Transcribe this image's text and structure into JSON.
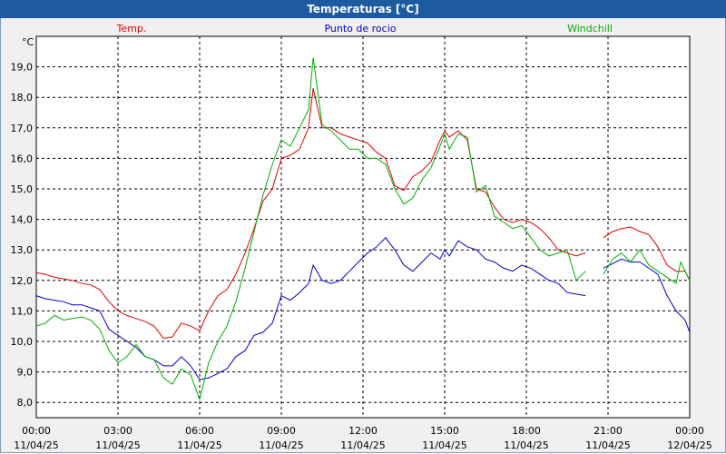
{
  "window": {
    "title": "Temperaturas [°C]"
  },
  "chart_data": {
    "type": "line",
    "ylabel": "°C",
    "ylim": [
      7.5,
      20.0
    ],
    "yticks": [
      8.0,
      9.0,
      10.0,
      11.0,
      12.0,
      13.0,
      14.0,
      15.0,
      16.0,
      17.0,
      18.0,
      19.0
    ],
    "ytick_labels": [
      "8,0",
      "9,0",
      "10,0",
      "11,0",
      "12,0",
      "13,0",
      "14,0",
      "15,0",
      "16,0",
      "17,0",
      "18,0",
      "19,0"
    ],
    "xlim": [
      0,
      24
    ],
    "xticks": [
      0,
      3,
      6,
      9,
      12,
      15,
      18,
      21,
      24
    ],
    "xtick_labels": [
      {
        "time": "00:00",
        "date": "11/04/25"
      },
      {
        "time": "03:00",
        "date": "11/04/25"
      },
      {
        "time": "06:00",
        "date": "11/04/25"
      },
      {
        "time": "09:00",
        "date": "11/04/25"
      },
      {
        "time": "12:00",
        "date": "11/04/25"
      },
      {
        "time": "15:00",
        "date": "11/04/25"
      },
      {
        "time": "18:00",
        "date": "11/04/25"
      },
      {
        "time": "21:00",
        "date": "11/04/25"
      },
      {
        "time": "00:00",
        "date": "12/04/25"
      }
    ],
    "grid": true,
    "legend_placement": "top",
    "series": [
      {
        "name": "Temp.",
        "color": "#e00000",
        "segments": [
          [
            [
              0,
              12.25
            ],
            [
              0.33,
              12.2
            ],
            [
              0.67,
              12.1
            ],
            [
              1.0,
              12.05
            ],
            [
              1.33,
              12.0
            ],
            [
              1.67,
              11.9
            ],
            [
              2.0,
              11.85
            ],
            [
              2.33,
              11.7
            ],
            [
              2.67,
              11.3
            ],
            [
              3.0,
              11.0
            ],
            [
              3.33,
              10.85
            ],
            [
              3.67,
              10.75
            ],
            [
              4.0,
              10.65
            ],
            [
              4.33,
              10.5
            ],
            [
              4.67,
              10.1
            ],
            [
              5.0,
              10.15
            ],
            [
              5.33,
              10.6
            ],
            [
              5.67,
              10.5
            ],
            [
              6.0,
              10.35
            ],
            [
              6.33,
              11.0
            ],
            [
              6.67,
              11.5
            ],
            [
              7.0,
              11.7
            ],
            [
              7.33,
              12.2
            ],
            [
              7.67,
              12.9
            ],
            [
              8.0,
              13.7
            ],
            [
              8.33,
              14.6
            ],
            [
              8.67,
              15.0
            ],
            [
              9.0,
              16.0
            ],
            [
              9.33,
              16.1
            ],
            [
              9.67,
              16.3
            ],
            [
              10.0,
              17.0
            ],
            [
              10.17,
              18.3
            ],
            [
              10.5,
              17.0
            ],
            [
              10.83,
              17.0
            ],
            [
              11.17,
              16.8
            ],
            [
              11.5,
              16.7
            ],
            [
              11.83,
              16.6
            ],
            [
              12.17,
              16.5
            ],
            [
              12.5,
              16.2
            ],
            [
              12.83,
              16.0
            ],
            [
              13.17,
              15.1
            ],
            [
              13.5,
              14.95
            ],
            [
              13.83,
              15.4
            ],
            [
              14.17,
              15.6
            ],
            [
              14.5,
              15.9
            ],
            [
              14.83,
              16.6
            ],
            [
              15.0,
              16.9
            ],
            [
              15.17,
              16.7
            ],
            [
              15.5,
              16.9
            ],
            [
              15.83,
              16.6
            ],
            [
              16.17,
              15.0
            ],
            [
              16.5,
              14.9
            ],
            [
              16.83,
              14.4
            ],
            [
              17.17,
              14.0
            ],
            [
              17.5,
              13.9
            ],
            [
              17.83,
              14.0
            ],
            [
              18.17,
              13.9
            ],
            [
              18.5,
              13.7
            ],
            [
              18.83,
              13.4
            ],
            [
              19.17,
              13.0
            ],
            [
              19.5,
              12.9
            ],
            [
              19.83,
              12.8
            ],
            [
              20.17,
              12.9
            ]
          ],
          [
            [
              20.83,
              13.4
            ],
            [
              21.17,
              13.6
            ],
            [
              21.5,
              13.7
            ],
            [
              21.83,
              13.75
            ],
            [
              22.17,
              13.6
            ],
            [
              22.5,
              13.5
            ],
            [
              22.83,
              13.1
            ],
            [
              23.17,
              12.5
            ],
            [
              23.5,
              12.3
            ],
            [
              23.83,
              12.3
            ],
            [
              24.0,
              12.0
            ]
          ]
        ]
      },
      {
        "name": "Punto de rocio",
        "color": "#0000cc",
        "segments": [
          [
            [
              0,
              11.5
            ],
            [
              0.33,
              11.4
            ],
            [
              0.67,
              11.35
            ],
            [
              1.0,
              11.3
            ],
            [
              1.33,
              11.2
            ],
            [
              1.67,
              11.2
            ],
            [
              2.0,
              11.1
            ],
            [
              2.33,
              11.0
            ],
            [
              2.67,
              10.4
            ],
            [
              3.0,
              10.2
            ],
            [
              3.33,
              10.0
            ],
            [
              3.67,
              9.8
            ],
            [
              4.0,
              9.5
            ],
            [
              4.33,
              9.4
            ],
            [
              4.67,
              9.2
            ],
            [
              5.0,
              9.2
            ],
            [
              5.33,
              9.5
            ],
            [
              5.67,
              9.2
            ],
            [
              6.0,
              8.75
            ],
            [
              6.33,
              8.8
            ],
            [
              6.67,
              8.95
            ],
            [
              7.0,
              9.1
            ],
            [
              7.33,
              9.5
            ],
            [
              7.67,
              9.7
            ],
            [
              8.0,
              10.2
            ],
            [
              8.33,
              10.3
            ],
            [
              8.67,
              10.6
            ],
            [
              9.0,
              11.5
            ],
            [
              9.33,
              11.35
            ],
            [
              9.67,
              11.6
            ],
            [
              10.0,
              11.9
            ],
            [
              10.17,
              12.5
            ],
            [
              10.5,
              12.0
            ],
            [
              10.83,
              11.9
            ],
            [
              11.17,
              12.0
            ],
            [
              11.5,
              12.3
            ],
            [
              11.83,
              12.6
            ],
            [
              12.17,
              12.9
            ],
            [
              12.5,
              13.1
            ],
            [
              12.83,
              13.4
            ],
            [
              13.17,
              13.0
            ],
            [
              13.5,
              12.5
            ],
            [
              13.83,
              12.3
            ],
            [
              14.17,
              12.6
            ],
            [
              14.5,
              12.9
            ],
            [
              14.83,
              12.7
            ],
            [
              15.0,
              13.0
            ],
            [
              15.17,
              12.8
            ],
            [
              15.5,
              13.3
            ],
            [
              15.83,
              13.1
            ],
            [
              16.17,
              13.0
            ],
            [
              16.5,
              12.7
            ],
            [
              16.83,
              12.6
            ],
            [
              17.17,
              12.4
            ],
            [
              17.5,
              12.3
            ],
            [
              17.83,
              12.5
            ],
            [
              18.17,
              12.4
            ],
            [
              18.5,
              12.2
            ],
            [
              18.83,
              12.0
            ],
            [
              19.17,
              11.9
            ],
            [
              19.5,
              11.6
            ],
            [
              19.83,
              11.55
            ],
            [
              20.17,
              11.5
            ]
          ],
          [
            [
              20.83,
              12.4
            ],
            [
              21.17,
              12.55
            ],
            [
              21.5,
              12.7
            ],
            [
              21.83,
              12.6
            ],
            [
              22.17,
              12.6
            ],
            [
              22.5,
              12.4
            ],
            [
              22.83,
              12.2
            ],
            [
              23.17,
              11.5
            ],
            [
              23.5,
              11.0
            ],
            [
              23.83,
              10.7
            ],
            [
              24.0,
              10.3
            ]
          ]
        ]
      },
      {
        "name": "Windchill",
        "color": "#00b000",
        "segments": [
          [
            [
              0,
              10.5
            ],
            [
              0.33,
              10.6
            ],
            [
              0.67,
              10.85
            ],
            [
              1.0,
              10.7
            ],
            [
              1.33,
              10.75
            ],
            [
              1.67,
              10.8
            ],
            [
              2.0,
              10.7
            ],
            [
              2.33,
              10.4
            ],
            [
              2.67,
              9.7
            ],
            [
              3.0,
              9.3
            ],
            [
              3.33,
              9.5
            ],
            [
              3.67,
              9.9
            ],
            [
              4.0,
              9.5
            ],
            [
              4.33,
              9.4
            ],
            [
              4.67,
              8.8
            ],
            [
              5.0,
              8.6
            ],
            [
              5.33,
              9.1
            ],
            [
              5.67,
              8.9
            ],
            [
              6.0,
              8.1
            ],
            [
              6.33,
              9.3
            ],
            [
              6.67,
              10.0
            ],
            [
              7.0,
              10.5
            ],
            [
              7.33,
              11.3
            ],
            [
              7.67,
              12.4
            ],
            [
              8.0,
              13.6
            ],
            [
              8.33,
              14.8
            ],
            [
              8.67,
              15.8
            ],
            [
              9.0,
              16.6
            ],
            [
              9.33,
              16.4
            ],
            [
              9.67,
              17.0
            ],
            [
              10.0,
              17.6
            ],
            [
              10.17,
              19.3
            ],
            [
              10.5,
              17.1
            ],
            [
              10.83,
              16.9
            ],
            [
              11.17,
              16.6
            ],
            [
              11.5,
              16.3
            ],
            [
              11.83,
              16.3
            ],
            [
              12.17,
              16.0
            ],
            [
              12.5,
              16.0
            ],
            [
              12.83,
              15.8
            ],
            [
              13.17,
              15.0
            ],
            [
              13.5,
              14.5
            ],
            [
              13.83,
              14.7
            ],
            [
              14.17,
              15.3
            ],
            [
              14.5,
              15.7
            ],
            [
              14.83,
              16.4
            ],
            [
              15.0,
              16.8
            ],
            [
              15.17,
              16.3
            ],
            [
              15.5,
              16.8
            ],
            [
              15.83,
              16.7
            ],
            [
              16.17,
              14.9
            ],
            [
              16.5,
              15.1
            ],
            [
              16.83,
              14.1
            ],
            [
              17.17,
              13.9
            ],
            [
              17.5,
              13.7
            ],
            [
              17.83,
              13.8
            ],
            [
              18.17,
              13.4
            ],
            [
              18.5,
              13.0
            ],
            [
              18.83,
              12.8
            ],
            [
              19.17,
              12.9
            ],
            [
              19.5,
              13.0
            ],
            [
              19.83,
              12.0
            ],
            [
              20.17,
              12.3
            ]
          ],
          [
            [
              20.83,
              12.2
            ],
            [
              21.17,
              12.7
            ],
            [
              21.5,
              12.9
            ],
            [
              21.83,
              12.6
            ],
            [
              22.17,
              13.0
            ],
            [
              22.5,
              12.5
            ],
            [
              22.83,
              12.3
            ],
            [
              23.17,
              12.1
            ],
            [
              23.5,
              11.9
            ],
            [
              23.67,
              12.6
            ],
            [
              24.0,
              12.0
            ]
          ]
        ]
      }
    ]
  }
}
